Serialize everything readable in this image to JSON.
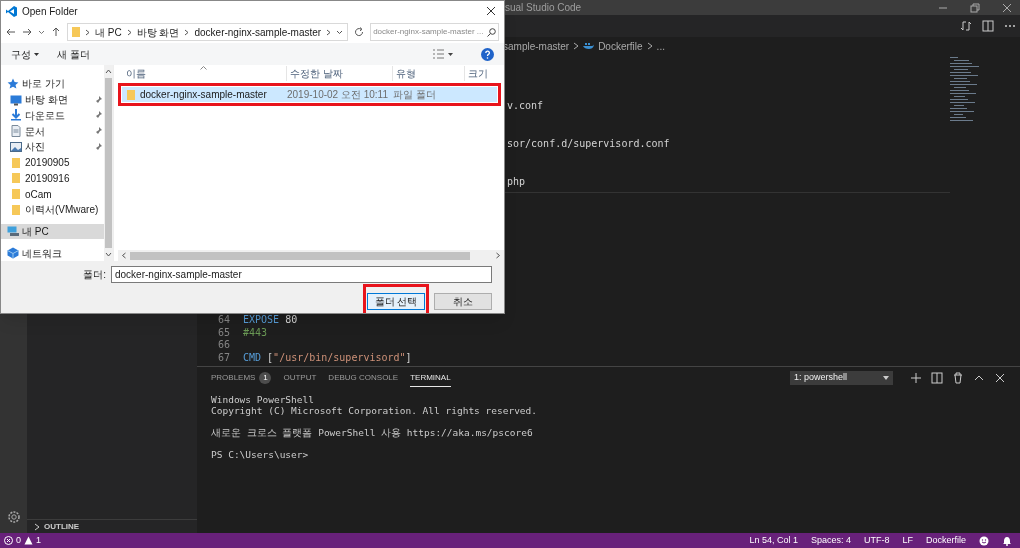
{
  "vscode": {
    "title": "sual Studio Code",
    "breadcrumb": [
      "sample-master",
      "Dockerfile",
      "..."
    ],
    "editor": {
      "partial_lines": [
        "v.conf",
        "sor/conf.d/supervisord.conf",
        "php"
      ],
      "lines": [
        {
          "number": "64",
          "tokens": [
            {
              "text": "EXPOSE",
              "kind": "keyword"
            },
            {
              "text": " 80",
              "kind": "plain"
            }
          ]
        },
        {
          "number": "65",
          "tokens": [
            {
              "text": "#443",
              "kind": "comment"
            }
          ]
        },
        {
          "number": "66"
        },
        {
          "number": "67",
          "tokens": [
            {
              "text": "CMD",
              "kind": "keyword"
            },
            {
              "text": " [",
              "kind": "plain"
            },
            {
              "text": "\"/usr/bin/supervisord\"",
              "kind": "string"
            },
            {
              "text": "]",
              "kind": "plain"
            }
          ]
        }
      ]
    },
    "panel": {
      "tabs": [
        {
          "label": "PROBLEMS",
          "badge": "1",
          "selected": false
        },
        {
          "label": "OUTPUT",
          "selected": false
        },
        {
          "label": "DEBUG CONSOLE",
          "selected": false
        },
        {
          "label": "TERMINAL",
          "selected": true
        }
      ],
      "terminal_select": "1: powershell",
      "terminal": [
        [
          "Windows PowerShell",
          "Copyright (C) Microsoft Corporation. All rights reserved."
        ],
        [
          "새로운 크로스 플랫폼 PowerShell 사용 https://aka.ms/pscore6"
        ],
        [
          "PS C:\\Users\\user>"
        ]
      ]
    },
    "sidebar": {
      "sections": [
        {
          "label": "OUTLINE",
          "expanded": false
        }
      ]
    },
    "status_bar": {
      "errors": "0",
      "warnings": "1",
      "items": [
        "Ln 54, Col 1",
        "Spaces: 4",
        "UTF-8",
        "LF",
        "Dockerfile"
      ]
    }
  },
  "dialog": {
    "title": "Open Folder",
    "path": [
      "내 PC",
      "바탕 화면",
      "docker-nginx-sample-master"
    ],
    "search_placeholder": "docker-nginx-sample-master ...",
    "toolbar": [
      "구성",
      "새 폴더"
    ],
    "nav": [
      {
        "label": "바로 가기",
        "kind": "star",
        "pinned": false,
        "selected": false
      },
      {
        "label": "바탕 화면",
        "kind": "desktop",
        "pinned": true,
        "selected": false
      },
      {
        "label": "다운로드",
        "kind": "download",
        "pinned": true,
        "selected": false
      },
      {
        "label": "문서",
        "kind": "document",
        "pinned": true,
        "selected": false
      },
      {
        "label": "사진",
        "kind": "pictures",
        "pinned": true,
        "selected": false
      },
      {
        "label": "20190905",
        "kind": "folder",
        "pinned": false,
        "selected": false
      },
      {
        "label": "20190916",
        "kind": "folder",
        "pinned": false,
        "selected": false
      },
      {
        "label": "oCam",
        "kind": "folder",
        "pinned": false,
        "selected": false
      },
      {
        "label": "이력서(VMware)",
        "kind": "folder",
        "pinned": false,
        "selected": false
      },
      {
        "label": "내 PC",
        "kind": "pc",
        "pinned": false,
        "selected": true
      },
      {
        "label": "네트워크",
        "kind": "network",
        "pinned": false,
        "selected": false
      }
    ],
    "columns": [
      "이름",
      "수정한 날짜",
      "유형",
      "크기"
    ],
    "rows": [
      {
        "name": "docker-nginx-sample-master",
        "date": "2019-10-02 오전 10:11",
        "type": "파일 폴더",
        "selected": true,
        "highlighted": true
      }
    ],
    "folder_label": "폴더:",
    "folder_value": "docker-nginx-sample-master",
    "buttons": [
      {
        "label": "폴더 선택",
        "highlighted": true
      },
      {
        "label": "취소",
        "highlighted": false
      }
    ]
  }
}
